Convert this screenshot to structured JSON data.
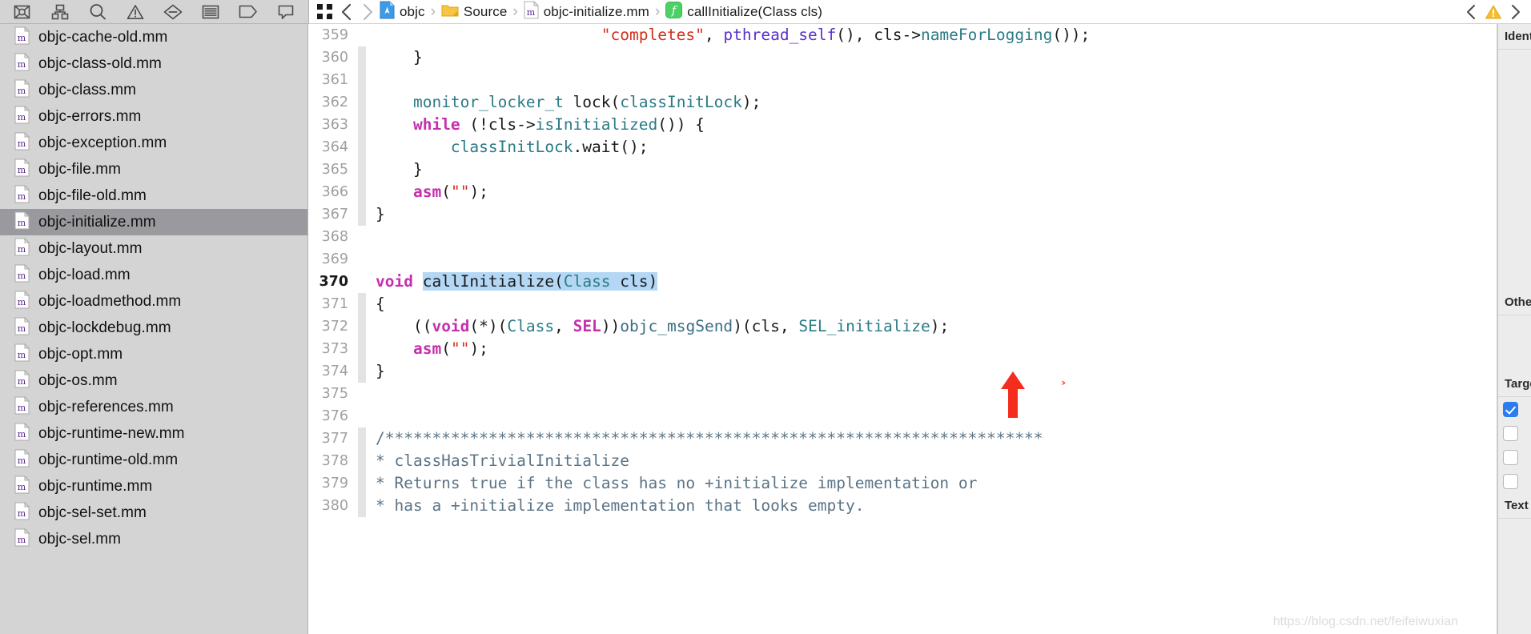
{
  "app": {
    "name": "Xcode"
  },
  "nav_toolbar": {
    "icons": [
      {
        "name": "project-navigator-icon",
        "label": "Project navigator"
      },
      {
        "name": "symbol-navigator-icon",
        "label": "Symbol navigator"
      },
      {
        "name": "find-navigator-icon",
        "label": "Find navigator"
      },
      {
        "name": "issue-navigator-icon",
        "label": "Issue navigator"
      },
      {
        "name": "test-navigator-icon",
        "label": "Test navigator"
      },
      {
        "name": "debug-navigator-icon",
        "label": "Debug navigator"
      },
      {
        "name": "breakpoint-navigator-icon",
        "label": "Breakpoint navigator"
      },
      {
        "name": "report-navigator-icon",
        "label": "Report navigator"
      }
    ]
  },
  "sidebar": {
    "files": [
      {
        "label": "objc-cache-old.mm",
        "icon": "m-file-icon",
        "selected": false
      },
      {
        "label": "objc-class-old.mm",
        "icon": "m-file-icon",
        "selected": false
      },
      {
        "label": "objc-class.mm",
        "icon": "m-file-icon",
        "selected": false
      },
      {
        "label": "objc-errors.mm",
        "icon": "m-file-icon",
        "selected": false
      },
      {
        "label": "objc-exception.mm",
        "icon": "m-file-icon",
        "selected": false
      },
      {
        "label": "objc-file.mm",
        "icon": "m-file-icon",
        "selected": false
      },
      {
        "label": "objc-file-old.mm",
        "icon": "m-file-icon",
        "selected": false
      },
      {
        "label": "objc-initialize.mm",
        "icon": "m-file-icon",
        "selected": true
      },
      {
        "label": "objc-layout.mm",
        "icon": "m-file-icon",
        "selected": false
      },
      {
        "label": "objc-load.mm",
        "icon": "m-file-icon",
        "selected": false
      },
      {
        "label": "objc-loadmethod.mm",
        "icon": "m-file-icon",
        "selected": false
      },
      {
        "label": "objc-lockdebug.mm",
        "icon": "m-file-icon",
        "selected": false
      },
      {
        "label": "objc-opt.mm",
        "icon": "m-file-icon",
        "selected": false
      },
      {
        "label": "objc-os.mm",
        "icon": "m-file-icon",
        "selected": false
      },
      {
        "label": "objc-references.mm",
        "icon": "m-file-icon",
        "selected": false
      },
      {
        "label": "objc-runtime-new.mm",
        "icon": "m-file-icon",
        "selected": false
      },
      {
        "label": "objc-runtime-old.mm",
        "icon": "m-file-icon",
        "selected": false
      },
      {
        "label": "objc-runtime.mm",
        "icon": "m-file-icon",
        "selected": false
      },
      {
        "label": "objc-sel-set.mm",
        "icon": "m-file-icon",
        "selected": false
      },
      {
        "label": "objc-sel.mm",
        "icon": "m-file-icon",
        "selected": false
      }
    ]
  },
  "jumpbar": {
    "related_items_icon": "related-items-icon",
    "back_label": "‹",
    "forward_label": "›",
    "breadcrumbs": [
      {
        "label": "objc",
        "icon": "project-icon"
      },
      {
        "label": "Source",
        "icon": "folder-icon"
      },
      {
        "label": "objc-initialize.mm",
        "icon": "m-file-icon"
      },
      {
        "label": "callInitialize(Class cls)",
        "icon": "function-icon"
      }
    ],
    "separator": "›",
    "right_controls": [
      {
        "name": "previous-issue-button",
        "label": "‹"
      },
      {
        "name": "warning-badge",
        "label": "!"
      },
      {
        "name": "next-issue-button",
        "label": "›"
      }
    ]
  },
  "editor": {
    "first_line": 359,
    "current_line": 370,
    "selection_text": "callInitialize(Class cls)",
    "lines": [
      {
        "n": 359,
        "fold": false,
        "tokens": [
          {
            "t": "                        ",
            "c": "plain"
          },
          {
            "t": "\"completes\"",
            "c": "str"
          },
          {
            "t": ", ",
            "c": "plain"
          },
          {
            "t": "pthread_self",
            "c": "call"
          },
          {
            "t": "(), cls->",
            "c": "plain"
          },
          {
            "t": "nameForLogging",
            "c": "type"
          },
          {
            "t": "());",
            "c": "plain"
          }
        ]
      },
      {
        "n": 360,
        "fold": true,
        "tokens": [
          {
            "t": "    }",
            "c": "plain"
          }
        ]
      },
      {
        "n": 361,
        "fold": true,
        "tokens": [
          {
            "t": "",
            "c": "plain"
          }
        ]
      },
      {
        "n": 362,
        "fold": true,
        "tokens": [
          {
            "t": "    ",
            "c": "plain"
          },
          {
            "t": "monitor_locker_t",
            "c": "type"
          },
          {
            "t": " lock(",
            "c": "plain"
          },
          {
            "t": "classInitLock",
            "c": "type"
          },
          {
            "t": ");",
            "c": "plain"
          }
        ]
      },
      {
        "n": 363,
        "fold": true,
        "tokens": [
          {
            "t": "    ",
            "c": "plain"
          },
          {
            "t": "while",
            "c": "kw"
          },
          {
            "t": " (!cls->",
            "c": "plain"
          },
          {
            "t": "isInitialized",
            "c": "type"
          },
          {
            "t": "()) {",
            "c": "plain"
          }
        ]
      },
      {
        "n": 364,
        "fold": true,
        "tokens": [
          {
            "t": "        ",
            "c": "plain"
          },
          {
            "t": "classInitLock",
            "c": "type"
          },
          {
            "t": ".wait();",
            "c": "plain"
          }
        ]
      },
      {
        "n": 365,
        "fold": true,
        "tokens": [
          {
            "t": "    }",
            "c": "plain"
          }
        ]
      },
      {
        "n": 366,
        "fold": true,
        "tokens": [
          {
            "t": "    ",
            "c": "plain"
          },
          {
            "t": "asm",
            "c": "kw"
          },
          {
            "t": "(",
            "c": "plain"
          },
          {
            "t": "\"\"",
            "c": "str"
          },
          {
            "t": ");",
            "c": "plain"
          }
        ]
      },
      {
        "n": 367,
        "fold": true,
        "tokens": [
          {
            "t": "}",
            "c": "plain"
          }
        ]
      },
      {
        "n": 368,
        "fold": false,
        "tokens": [
          {
            "t": "",
            "c": "plain"
          }
        ]
      },
      {
        "n": 369,
        "fold": false,
        "tokens": [
          {
            "t": "",
            "c": "plain"
          }
        ]
      },
      {
        "n": 370,
        "fold": false,
        "current": true,
        "tokens": [
          {
            "t": "void",
            "c": "kw"
          },
          {
            "t": " ",
            "c": "plain"
          },
          {
            "t": "callInitialize",
            "c": "plain",
            "hl": true
          },
          {
            "t": "(",
            "c": "plain",
            "hl": true
          },
          {
            "t": "Class",
            "c": "type",
            "hl": true
          },
          {
            "t": " cls)",
            "c": "plain",
            "hl": true
          }
        ]
      },
      {
        "n": 371,
        "fold": true,
        "tokens": [
          {
            "t": "{",
            "c": "plain"
          }
        ]
      },
      {
        "n": 372,
        "fold": true,
        "tokens": [
          {
            "t": "    ((",
            "c": "plain"
          },
          {
            "t": "void",
            "c": "kw"
          },
          {
            "t": "(*)(",
            "c": "plain"
          },
          {
            "t": "Class",
            "c": "type"
          },
          {
            "t": ", ",
            "c": "plain"
          },
          {
            "t": "SEL",
            "c": "kw"
          },
          {
            "t": "))",
            "c": "plain"
          },
          {
            "t": "objc_msgSend",
            "c": "fn"
          },
          {
            "t": ")(cls, ",
            "c": "plain"
          },
          {
            "t": "SEL_initialize",
            "c": "type"
          },
          {
            "t": ");",
            "c": "plain"
          }
        ]
      },
      {
        "n": 373,
        "fold": true,
        "tokens": [
          {
            "t": "    ",
            "c": "plain"
          },
          {
            "t": "asm",
            "c": "kw"
          },
          {
            "t": "(",
            "c": "plain"
          },
          {
            "t": "\"\"",
            "c": "str"
          },
          {
            "t": ");",
            "c": "plain"
          }
        ]
      },
      {
        "n": 374,
        "fold": true,
        "tokens": [
          {
            "t": "}",
            "c": "plain"
          }
        ]
      },
      {
        "n": 375,
        "fold": false,
        "tokens": [
          {
            "t": "",
            "c": "plain"
          }
        ]
      },
      {
        "n": 376,
        "fold": false,
        "tokens": [
          {
            "t": "",
            "c": "plain"
          }
        ]
      },
      {
        "n": 377,
        "fold": true,
        "tokens": [
          {
            "t": "/**********************************************************************",
            "c": "cmt"
          }
        ]
      },
      {
        "n": 378,
        "fold": true,
        "tokens": [
          {
            "t": "* classHasTrivialInitialize",
            "c": "cmt"
          }
        ]
      },
      {
        "n": 379,
        "fold": true,
        "tokens": [
          {
            "t": "* Returns true if the class has no +initialize implementation or",
            "c": "cmt"
          }
        ]
      },
      {
        "n": 380,
        "fold": true,
        "tokens": [
          {
            "t": "* has a +initialize implementation that looks empty.",
            "c": "cmt"
          }
        ]
      }
    ]
  },
  "annotations": {
    "arrow": {
      "name": "red-up-arrow",
      "color": "#f42d1c"
    },
    "caret": {
      "name": "red-caret-marker",
      "text": "›",
      "color": "#ff2a16"
    }
  },
  "inspector": {
    "sections": [
      {
        "label": "Identity and Type"
      },
      {
        "label": "Other"
      },
      {
        "label": "Target Membership"
      },
      {
        "label": "Text Settings"
      }
    ],
    "checkboxes": [
      true,
      false,
      false,
      false
    ]
  },
  "watermark": {
    "text": "https://blog.csdn.net/feifeiwuxian"
  },
  "colors": {
    "keyword": "#c52fae",
    "type": "#2b7b86",
    "string": "#d12f1b",
    "comment": "#5c7486",
    "call": "#5a32c8",
    "selection": "#b3d7f5",
    "annotation_red": "#f42d1c",
    "sidebar_bg": "#d4d4d4",
    "sidebar_selected": "#9a999e"
  }
}
